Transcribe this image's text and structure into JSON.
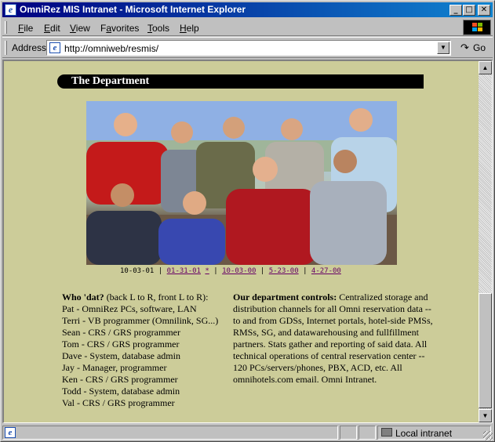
{
  "window": {
    "title": "OmniRez MIS Intranet - Microsoft Internet Explorer",
    "controls": {
      "minimize": "_",
      "maximize": "□",
      "close": "✕"
    }
  },
  "menu": {
    "items": [
      {
        "label": "File",
        "accel": "F",
        "rest": "ile"
      },
      {
        "label": "Edit",
        "accel": "E",
        "rest": "dit"
      },
      {
        "label": "View",
        "accel": "V",
        "rest": "iew"
      },
      {
        "label": "Favorites",
        "accel": "a",
        "pre": "F",
        "rest": "vorites"
      },
      {
        "label": "Tools",
        "accel": "T",
        "rest": "ools"
      },
      {
        "label": "Help",
        "accel": "H",
        "rest": "elp"
      }
    ]
  },
  "address": {
    "label": "Address",
    "url": "http://omniweb/resmis/",
    "go_label": "Go"
  },
  "page": {
    "heading": "The Department",
    "photo_dates": {
      "current": "10-03-01",
      "separator": "|",
      "links": [
        "01-31-01",
        "*",
        "10-03-00",
        "5-23-00",
        "4-27-00"
      ]
    },
    "who": {
      "title": "Who 'dat?",
      "subtitle": " (back L to R, front L to R):",
      "people": [
        "Pat - OmniRez PCs, software, LAN",
        "Terri - VB programmer (Omnilink, SG...)",
        "Sean - CRS / GRS programmer",
        "Tom - CRS / GRS programmer",
        "Dave - System, database admin",
        "Jay - Manager, programmer",
        "Ken - CRS / GRS programmer",
        "Todd - System, database admin",
        "Val - CRS / GRS programmer"
      ]
    },
    "controls": {
      "title": "Our department controls:",
      "text": " Centralized storage and distribution channels for all Omni reservation data -- to and from GDSs, Internet portals, hotel-side PMSs, RMSs, SG, and datawarehousing and fullfillment partners. Stats gather and reporting of said data. All technical operations of central reservation center -- 120 PCs/servers/phones, PBX, ACD, etc. All omnihotels.com email. Omni Intranet."
    }
  },
  "status": {
    "zone": "Local intranet"
  },
  "colors": {
    "page_background": "#cccc99",
    "title_bar": "#000080",
    "link_visited": "#660066"
  }
}
